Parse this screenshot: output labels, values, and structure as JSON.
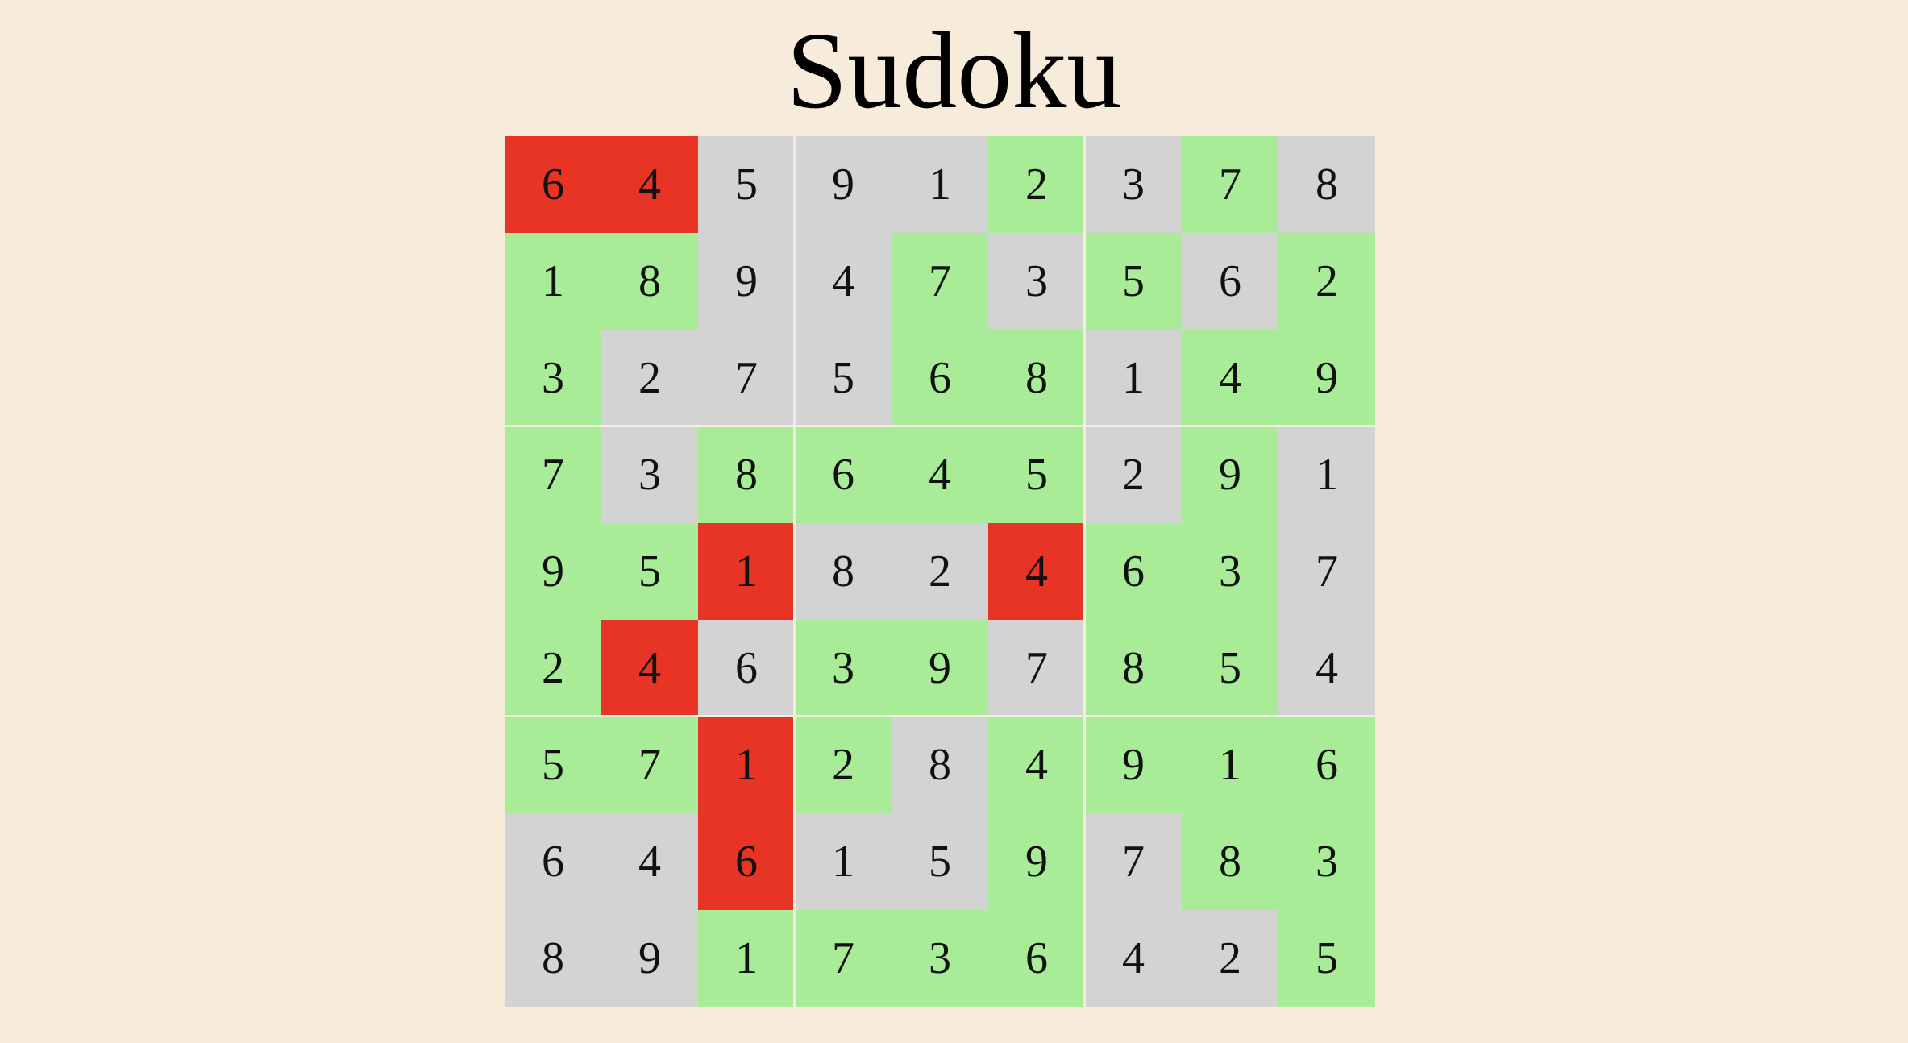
{
  "title": "Sudoku",
  "colors": {
    "background": "#f7ebdb",
    "given": "#d3d3d3",
    "correct": "#a8ec98",
    "wrong": "#e83424",
    "divider": "#f3ecdf"
  },
  "board": {
    "rows": [
      [
        {
          "v": "6",
          "s": "wrong"
        },
        {
          "v": "4",
          "s": "wrong"
        },
        {
          "v": "5",
          "s": "given"
        },
        {
          "v": "9",
          "s": "given"
        },
        {
          "v": "1",
          "s": "given"
        },
        {
          "v": "2",
          "s": "correct"
        },
        {
          "v": "3",
          "s": "given"
        },
        {
          "v": "7",
          "s": "correct"
        },
        {
          "v": "8",
          "s": "given"
        }
      ],
      [
        {
          "v": "1",
          "s": "correct"
        },
        {
          "v": "8",
          "s": "correct"
        },
        {
          "v": "9",
          "s": "given"
        },
        {
          "v": "4",
          "s": "given"
        },
        {
          "v": "7",
          "s": "correct"
        },
        {
          "v": "3",
          "s": "given"
        },
        {
          "v": "5",
          "s": "correct"
        },
        {
          "v": "6",
          "s": "given"
        },
        {
          "v": "2",
          "s": "correct"
        }
      ],
      [
        {
          "v": "3",
          "s": "correct"
        },
        {
          "v": "2",
          "s": "given"
        },
        {
          "v": "7",
          "s": "given"
        },
        {
          "v": "5",
          "s": "given"
        },
        {
          "v": "6",
          "s": "correct"
        },
        {
          "v": "8",
          "s": "correct"
        },
        {
          "v": "1",
          "s": "given"
        },
        {
          "v": "4",
          "s": "correct"
        },
        {
          "v": "9",
          "s": "correct"
        }
      ],
      [
        {
          "v": "7",
          "s": "correct"
        },
        {
          "v": "3",
          "s": "given"
        },
        {
          "v": "8",
          "s": "correct"
        },
        {
          "v": "6",
          "s": "correct"
        },
        {
          "v": "4",
          "s": "correct"
        },
        {
          "v": "5",
          "s": "correct"
        },
        {
          "v": "2",
          "s": "given"
        },
        {
          "v": "9",
          "s": "correct"
        },
        {
          "v": "1",
          "s": "given"
        }
      ],
      [
        {
          "v": "9",
          "s": "correct"
        },
        {
          "v": "5",
          "s": "correct"
        },
        {
          "v": "1",
          "s": "wrong"
        },
        {
          "v": "8",
          "s": "given"
        },
        {
          "v": "2",
          "s": "given"
        },
        {
          "v": "4",
          "s": "wrong"
        },
        {
          "v": "6",
          "s": "correct"
        },
        {
          "v": "3",
          "s": "correct"
        },
        {
          "v": "7",
          "s": "given"
        }
      ],
      [
        {
          "v": "2",
          "s": "correct"
        },
        {
          "v": "4",
          "s": "wrong"
        },
        {
          "v": "6",
          "s": "given"
        },
        {
          "v": "3",
          "s": "correct"
        },
        {
          "v": "9",
          "s": "correct"
        },
        {
          "v": "7",
          "s": "given"
        },
        {
          "v": "8",
          "s": "correct"
        },
        {
          "v": "5",
          "s": "correct"
        },
        {
          "v": "4",
          "s": "given"
        }
      ],
      [
        {
          "v": "5",
          "s": "correct"
        },
        {
          "v": "7",
          "s": "correct"
        },
        {
          "v": "1",
          "s": "wrong"
        },
        {
          "v": "2",
          "s": "correct"
        },
        {
          "v": "8",
          "s": "given"
        },
        {
          "v": "4",
          "s": "correct"
        },
        {
          "v": "9",
          "s": "correct"
        },
        {
          "v": "1",
          "s": "correct"
        },
        {
          "v": "6",
          "s": "correct"
        }
      ],
      [
        {
          "v": "6",
          "s": "given"
        },
        {
          "v": "4",
          "s": "given"
        },
        {
          "v": "6",
          "s": "wrong"
        },
        {
          "v": "1",
          "s": "given"
        },
        {
          "v": "5",
          "s": "given"
        },
        {
          "v": "9",
          "s": "correct"
        },
        {
          "v": "7",
          "s": "given"
        },
        {
          "v": "8",
          "s": "correct"
        },
        {
          "v": "3",
          "s": "correct"
        }
      ],
      [
        {
          "v": "8",
          "s": "given"
        },
        {
          "v": "9",
          "s": "given"
        },
        {
          "v": "1",
          "s": "correct"
        },
        {
          "v": "7",
          "s": "correct"
        },
        {
          "v": "3",
          "s": "correct"
        },
        {
          "v": "6",
          "s": "correct"
        },
        {
          "v": "4",
          "s": "given"
        },
        {
          "v": "2",
          "s": "given"
        },
        {
          "v": "5",
          "s": "correct"
        }
      ]
    ]
  }
}
